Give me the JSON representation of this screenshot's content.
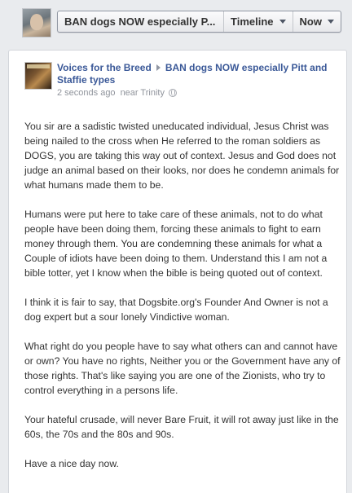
{
  "topbar": {
    "title_button": "BAN dogs NOW especially P...",
    "timeline_button": "Timeline",
    "now_button": "Now"
  },
  "post": {
    "page_name": "Voices for the Breed",
    "target_page": "BAN dogs NOW especially Pitt and Staffie types",
    "time_ago": "2 seconds ago",
    "location": "near Trinity",
    "paragraphs": [
      "You sir are a sadistic twisted uneducated individual, Jesus Christ was being nailed to the cross when He referred to the roman soldiers as DOGS, you are taking this way out of context. Jesus and God does not judge an animal based on their looks, nor does he condemn animals for what humans made them to be.",
      "Humans were put here to take care of these animals, not to do what people have been doing them, forcing these animals to fight to earn money through them. You are condemning these animals for what a Couple of idiots have been doing to them. Understand this I am not a bible totter, yet I know when the bible is being quoted out of context.",
      "I think it is fair to say, that Dogsbite.org's Founder And Owner is not a dog expert but a sour lonely Vindictive woman.",
      "What right do you people have to say what others can and cannot have or own? You have no rights, Neither you or the Government have any of those rights. That's like saying you are one of the Zionists, who try to control everything in a persons life.",
      "Your hateful crusade, will never Bare Fruit, it will rot away just like in the 60s, the 70s and the 80s and 90s.",
      "Have a nice day now."
    ]
  },
  "icons": {
    "profile": "profile-photo",
    "page": "page-thumbnail",
    "dropdown": "caret-down-icon",
    "breadcrumb": "triangle-right-icon",
    "privacy": "globe-icon"
  }
}
